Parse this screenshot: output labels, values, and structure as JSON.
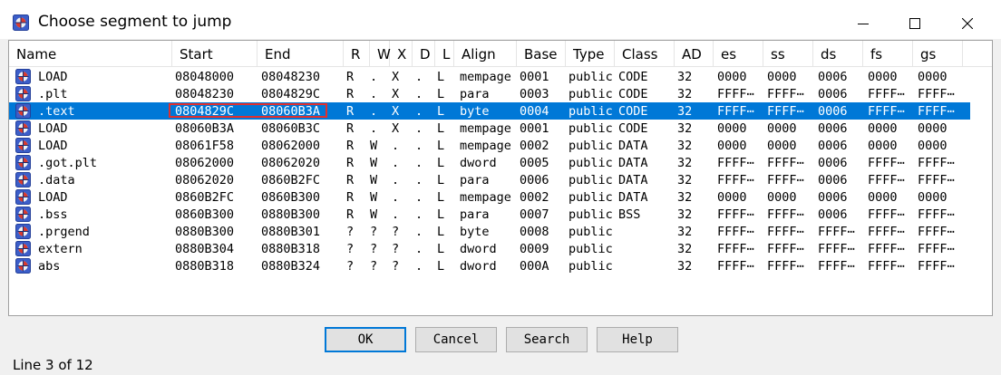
{
  "window": {
    "title": "Choose segment to jump",
    "controls": [
      "minimize-icon",
      "maximize-icon",
      "close-icon"
    ]
  },
  "columns": [
    "Name",
    "Start",
    "End",
    "R",
    "W",
    "X",
    "D",
    "L",
    "Align",
    "Base",
    "Type",
    "Class",
    "AD",
    "es",
    "ss",
    "ds",
    "fs",
    "gs"
  ],
  "rows": [
    [
      "LOAD",
      "08048000",
      "08048230",
      "R",
      ".",
      "X",
      ".",
      "L",
      "mempage",
      "0001",
      "public",
      "CODE",
      "32",
      "0000",
      "0000",
      "0006",
      "0000",
      "0000"
    ],
    [
      ".plt",
      "08048230",
      "0804829C",
      "R",
      ".",
      "X",
      ".",
      "L",
      "para",
      "0003",
      "public",
      "CODE",
      "32",
      "FFFF⋯",
      "FFFF⋯",
      "0006",
      "FFFF⋯",
      "FFFF⋯"
    ],
    [
      ".text",
      "0804829C",
      "08060B3A",
      "R",
      ".",
      "X",
      ".",
      "L",
      "byte",
      "0004",
      "public",
      "CODE",
      "32",
      "FFFF⋯",
      "FFFF⋯",
      "0006",
      "FFFF⋯",
      "FFFF⋯"
    ],
    [
      "LOAD",
      "08060B3A",
      "08060B3C",
      "R",
      ".",
      "X",
      ".",
      "L",
      "mempage",
      "0001",
      "public",
      "CODE",
      "32",
      "0000",
      "0000",
      "0006",
      "0000",
      "0000"
    ],
    [
      "LOAD",
      "08061F58",
      "08062000",
      "R",
      "W",
      ".",
      ".",
      "L",
      "mempage",
      "0002",
      "public",
      "DATA",
      "32",
      "0000",
      "0000",
      "0006",
      "0000",
      "0000"
    ],
    [
      ".got.plt",
      "08062000",
      "08062020",
      "R",
      "W",
      ".",
      ".",
      "L",
      "dword",
      "0005",
      "public",
      "DATA",
      "32",
      "FFFF⋯",
      "FFFF⋯",
      "0006",
      "FFFF⋯",
      "FFFF⋯"
    ],
    [
      ".data",
      "08062020",
      "0860B2FC",
      "R",
      "W",
      ".",
      ".",
      "L",
      "para",
      "0006",
      "public",
      "DATA",
      "32",
      "FFFF⋯",
      "FFFF⋯",
      "0006",
      "FFFF⋯",
      "FFFF⋯"
    ],
    [
      "LOAD",
      "0860B2FC",
      "0860B300",
      "R",
      "W",
      ".",
      ".",
      "L",
      "mempage",
      "0002",
      "public",
      "DATA",
      "32",
      "0000",
      "0000",
      "0006",
      "0000",
      "0000"
    ],
    [
      ".bss",
      "0860B300",
      "0880B300",
      "R",
      "W",
      ".",
      ".",
      "L",
      "para",
      "0007",
      "public",
      "BSS",
      "32",
      "FFFF⋯",
      "FFFF⋯",
      "0006",
      "FFFF⋯",
      "FFFF⋯"
    ],
    [
      ".prgend",
      "0880B300",
      "0880B301",
      "?",
      "?",
      "?",
      ".",
      "L",
      "byte",
      "0008",
      "public",
      "",
      "32",
      "FFFF⋯",
      "FFFF⋯",
      "FFFF⋯",
      "FFFF⋯",
      "FFFF⋯"
    ],
    [
      "extern",
      "0880B304",
      "0880B318",
      "?",
      "?",
      "?",
      ".",
      "L",
      "dword",
      "0009",
      "public",
      "",
      "32",
      "FFFF⋯",
      "FFFF⋯",
      "FFFF⋯",
      "FFFF⋯",
      "FFFF⋯"
    ],
    [
      "abs",
      "0880B318",
      "0880B324",
      "?",
      "?",
      "?",
      ".",
      "L",
      "dword",
      "000A",
      "public",
      "",
      "32",
      "FFFF⋯",
      "FFFF⋯",
      "FFFF⋯",
      "FFFF⋯",
      "FFFF⋯"
    ]
  ],
  "selected_row": 3,
  "buttons": {
    "ok": "OK",
    "cancel": "Cancel",
    "search": "Search",
    "help": "Help"
  },
  "status": "Line 3 of 12",
  "colors": {
    "selection": "#0078d7",
    "highlight_box": "#e0302e"
  }
}
